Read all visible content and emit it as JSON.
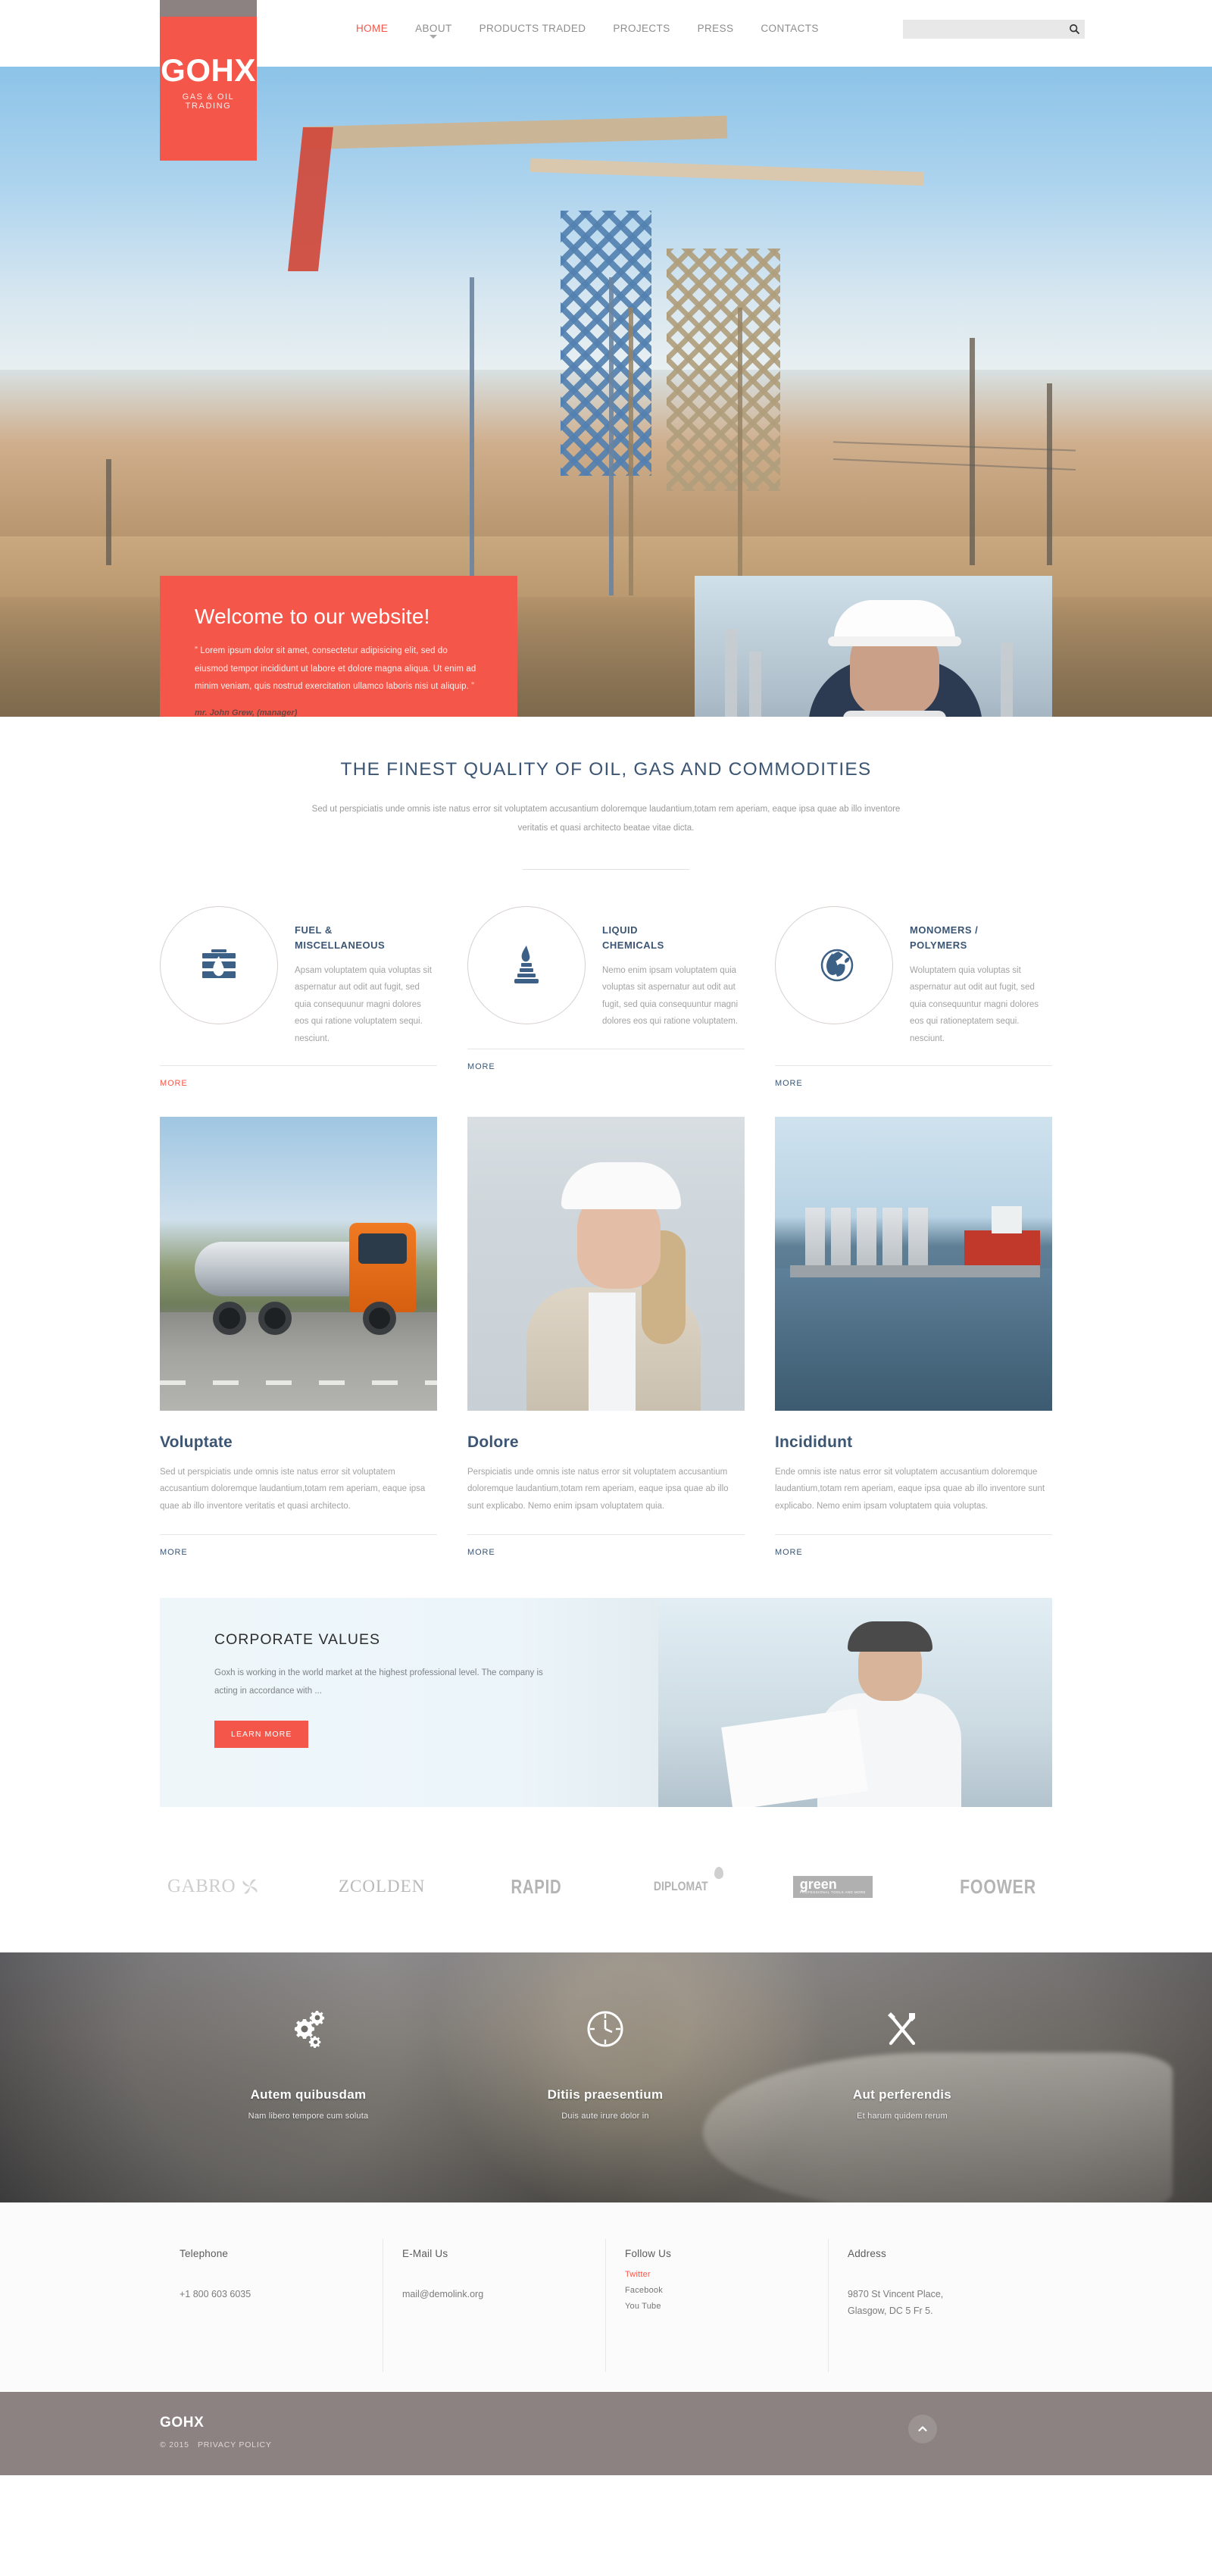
{
  "brand": {
    "name": "GOHX",
    "tagline": "GAS & OIL TRADING",
    "accent_color": "#f4574a",
    "dark_blue": "#3b5573",
    "footer_gray": "#8b8281"
  },
  "header": {
    "nav": [
      {
        "label": "HOME",
        "active": true,
        "has_dropdown": false
      },
      {
        "label": "ABOUT",
        "active": false,
        "has_dropdown": true
      },
      {
        "label": "PRODUCTS TRADED",
        "active": false,
        "has_dropdown": false
      },
      {
        "label": "PROJECTS",
        "active": false,
        "has_dropdown": false
      },
      {
        "label": "PRESS",
        "active": false,
        "has_dropdown": false
      },
      {
        "label": "CONTACTS",
        "active": false,
        "has_dropdown": false
      }
    ],
    "search": {
      "value": "",
      "placeholder": "",
      "icon": "search-icon"
    }
  },
  "hero": {
    "heading": "Welcome to our website!",
    "quote": "”  Lorem ipsum dolor sit amet, consectetur adipisicing elit, sed do eiusmod tempor incididunt ut labore et dolore magna aliqua. Ut enim ad minim veniam, quis nostrud exercitation ullamco laboris nisi ut aliquip. ”",
    "author": "mr. John Grew, (manager)",
    "slides": 3,
    "active_slide": 1
  },
  "intro": {
    "title": "THE FINEST QUALITY OF OIL, GAS AND COMMODITIES",
    "subtitle": "Sed ut perspiciatis unde omnis iste natus error sit voluptatem accusantium doloremque laudantium,totam rem aperiam, eaque ipsa quae ab illo inventore veritatis et quasi architecto beatae vitae dicta."
  },
  "services": [
    {
      "icon": "oil-barrel-icon",
      "title": "FUEL &\nMISCELLANEOUS",
      "title_line1": "FUEL &",
      "title_line2": "MISCELLANEOUS",
      "text": "Apsam voluptatem quia voluptas sit aspernatur aut odit aut fugit, sed quia consequunur magni dolores eos qui ratione voluptatem sequi. nesciunt.",
      "more_label": "MORE",
      "more_highlighted": true
    },
    {
      "icon": "chemical-flame-icon",
      "title_line1": "LIQUID",
      "title_line2": "CHEMICALS",
      "text": "Nemo enim ipsam voluptatem quia voluptas sit aspernatur aut odit aut fugit, sed quia consequuntur magni dolores eos qui ratione voluptatem.",
      "more_label": "MORE",
      "more_highlighted": false
    },
    {
      "icon": "globe-leaf-icon",
      "title_line1": "MONOMERS /",
      "title_line2": " POLYMERS",
      "text": "Woluptatem quia voluptas sit aspernatur aut odit aut fugit, sed quia consequuntur magni dolores eos qui rationeptatem sequi. nesciunt.",
      "more_label": "MORE",
      "more_highlighted": false
    }
  ],
  "cards": [
    {
      "image": "tanker-truck-photo",
      "title": "Voluptate",
      "text": "Sed ut perspiciatis unde omnis iste natus error sit voluptatem accusantium doloremque laudantium,totam rem aperiam, eaque ipsa quae ab illo inventore veritatis et quasi architecto.",
      "more_label": "MORE"
    },
    {
      "image": "engineer-woman-photo",
      "title": "Dolore",
      "text": "Perspiciatis unde omnis iste natus error sit voluptatem accusantium doloremque laudantium,totam rem aperiam, eaque ipsa quae ab illo sunt explicabo. Nemo enim ipsam voluptatem quia.",
      "more_label": "MORE"
    },
    {
      "image": "port-terminal-photo",
      "title": "Incididunt",
      "text": "Ende omnis iste natus error sit voluptatem accusantium doloremque laudantium,totam rem aperiam, eaque ipsa quae ab illo inventore sunt explicabo. Nemo enim ipsam voluptatem quia voluptas.",
      "more_label": "MORE"
    }
  ],
  "corporate_values": {
    "title": "CORPORATE VALUES",
    "text": "Goxh is working in the world market at the highest professional level. The company is acting in accordance with ...",
    "button_label": "LEARN MORE"
  },
  "brands": [
    {
      "name": "GABRO",
      "style": "serif-with-swirl"
    },
    {
      "name": "ZCOLDEN",
      "style": "serif"
    },
    {
      "name": "RAPID",
      "style": "condensed-bold"
    },
    {
      "name": "DIPLOMAT",
      "style": "condensed-bold-drop"
    },
    {
      "name": "green",
      "sub": "PROFESSIONAL TOOLS AND MORE",
      "style": "boxed"
    },
    {
      "name": "FOOWER",
      "style": "condensed-bold"
    }
  ],
  "features": [
    {
      "icon": "gears-icon",
      "title": "Autem quibusdam",
      "text": "Nam libero tempore cum soluta"
    },
    {
      "icon": "clock-icon",
      "title": "Ditiis praesentium",
      "text": "Duis aute irure dolor in"
    },
    {
      "icon": "wrench-screwdriver-icon",
      "title": "Aut perferendis",
      "text": "Et harum quidem rerum"
    }
  ],
  "footer": {
    "columns": [
      {
        "heading": "Telephone",
        "value": "+1 800 603 6035",
        "type": "text"
      },
      {
        "heading": "E-Mail Us",
        "value": "mail@demolink.org",
        "type": "text"
      },
      {
        "heading": "Follow Us",
        "type": "links",
        "links": [
          {
            "label": "Twitter",
            "highlighted": true
          },
          {
            "label": "Facebook",
            "highlighted": false
          },
          {
            "label": "You Tube",
            "highlighted": false
          }
        ]
      },
      {
        "heading": "Address",
        "value": "9870 St Vincent Place,\nGlasgow, DC  5 Fr  5.",
        "type": "text"
      }
    ]
  },
  "bottom": {
    "logo": "GOHX",
    "copyright": "© 2015",
    "privacy_label": "PRIVACY POLICY",
    "to_top_icon": "chevron-up-icon"
  }
}
